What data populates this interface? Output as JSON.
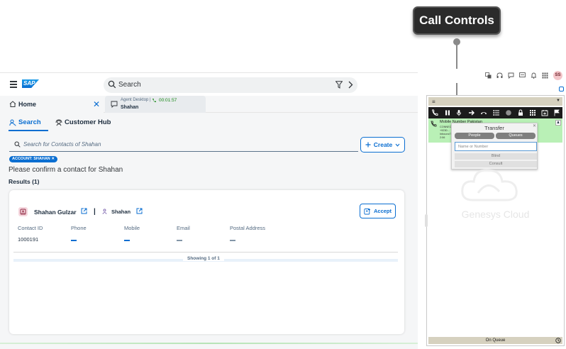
{
  "callout": {
    "label": "Call Controls"
  },
  "shell": {
    "search_placeholder": "Search",
    "logo": "SAP"
  },
  "tabs": {
    "home_label": "Home",
    "agent_desktop_label": "Agent Desktop |",
    "agent_timer": "00:01:57",
    "agent_contact": "Shahan"
  },
  "subtabs": {
    "search_label": "Search",
    "customer_hub_label": "Customer Hub"
  },
  "contact_search": {
    "placeholder": "Search for Contacts of Shahan",
    "create_label": "Create"
  },
  "token": {
    "label": "ACCOUNT: SHAHAN"
  },
  "confirm_text": "Please confirm a contact for Shahan",
  "results_label": "Results (1)",
  "result_card": {
    "contact_name": "Shahan Gulzar",
    "separator": "|",
    "account_name": "Shahan",
    "accept_label": "Accept",
    "columns": [
      "Contact ID",
      "Phone",
      "Mobile",
      "Email",
      "Postal Address"
    ],
    "contact_id": "1000191",
    "showing": "Showing 1 of 1"
  },
  "browser": {
    "avatar_initials": "SS"
  },
  "genesys": {
    "call_label": "Mobile Number Pakistan",
    "call_status_lines": [
      "CONNECT...",
      "+9230...",
      "Inbound T...",
      "2:06"
    ],
    "brand": "Genesys Cloud",
    "status": "On Queue"
  },
  "transfer": {
    "title": "Transfer",
    "people_label": "People",
    "queues_label": "Queues",
    "input_placeholder": "Name or Number",
    "blind_label": "Blind",
    "consult_label": "Consult"
  },
  "colors": {
    "sap_blue": "#0a6ed1",
    "call_green": "#b9f0b6",
    "callout_bg": "#2b2b2b"
  }
}
